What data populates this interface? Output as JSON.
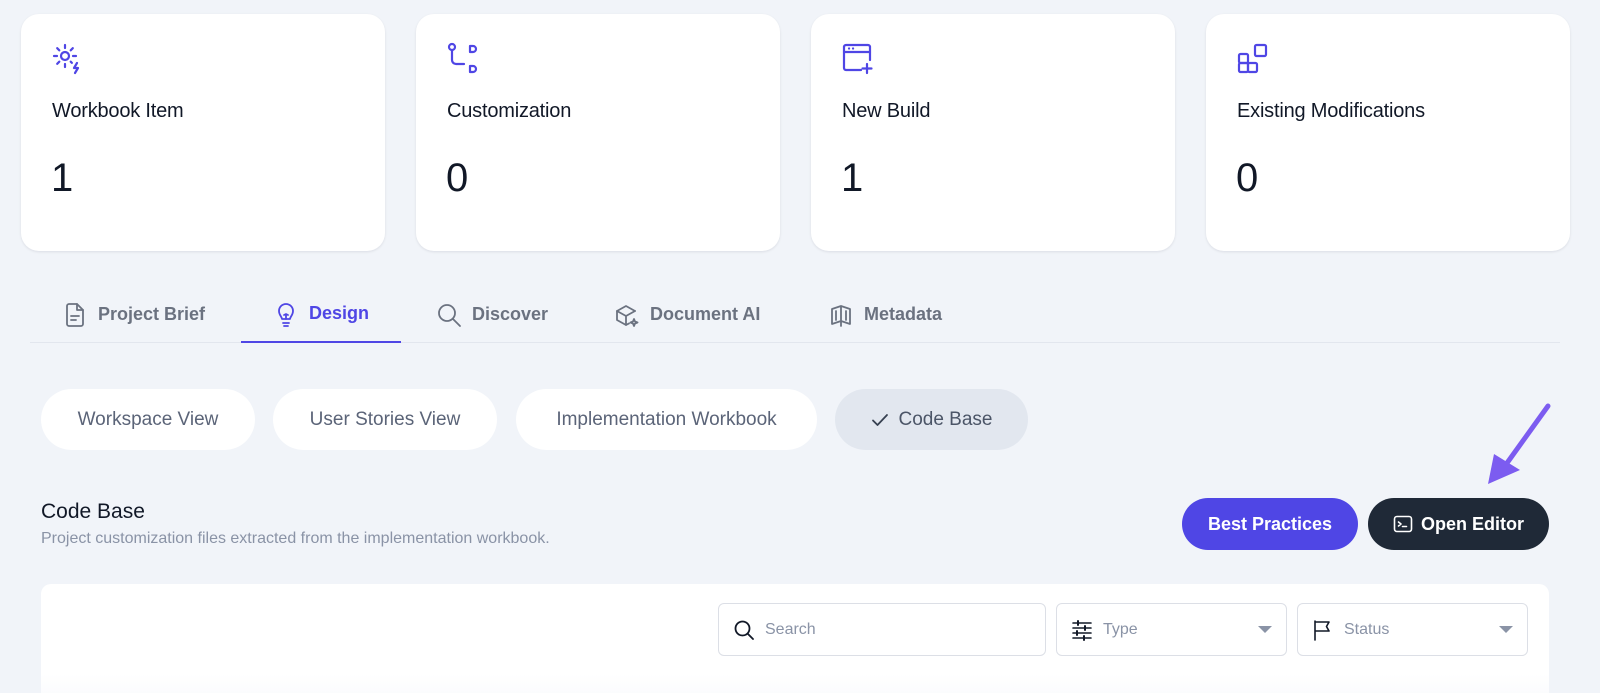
{
  "cards": [
    {
      "label": "Workbook Item",
      "value": "1",
      "icon": "gear-bolt-icon"
    },
    {
      "label": "Customization",
      "value": "0",
      "icon": "git-branch-icon"
    },
    {
      "label": "New Build",
      "value": "1",
      "icon": "window-plus-icon"
    },
    {
      "label": "Existing Modifications",
      "value": "0",
      "icon": "blocks-icon"
    }
  ],
  "tabs": [
    {
      "label": "Project Brief",
      "icon": "document-icon",
      "active": false
    },
    {
      "label": "Design",
      "icon": "lightbulb-icon",
      "active": true
    },
    {
      "label": "Discover",
      "icon": "search-icon",
      "active": false
    },
    {
      "label": "Document AI",
      "icon": "cube-sparkle-icon",
      "active": false
    },
    {
      "label": "Metadata",
      "icon": "book-open-icon",
      "active": false
    }
  ],
  "views": [
    {
      "label": "Workspace View",
      "selected": false
    },
    {
      "label": "User Stories View",
      "selected": false
    },
    {
      "label": "Implementation Workbook",
      "selected": false
    },
    {
      "label": "Code Base",
      "selected": true
    }
  ],
  "section": {
    "title": "Code Base",
    "subtitle": "Project customization files extracted from the implementation workbook."
  },
  "buttons": {
    "best_practices": "Best Practices",
    "open_editor": "Open Editor"
  },
  "filters": {
    "search_placeholder": "Search",
    "type_label": "Type",
    "status_label": "Status"
  },
  "colors": {
    "accent": "#4f46e5",
    "dark": "#1f2937",
    "arrow": "#7c5cf0"
  }
}
